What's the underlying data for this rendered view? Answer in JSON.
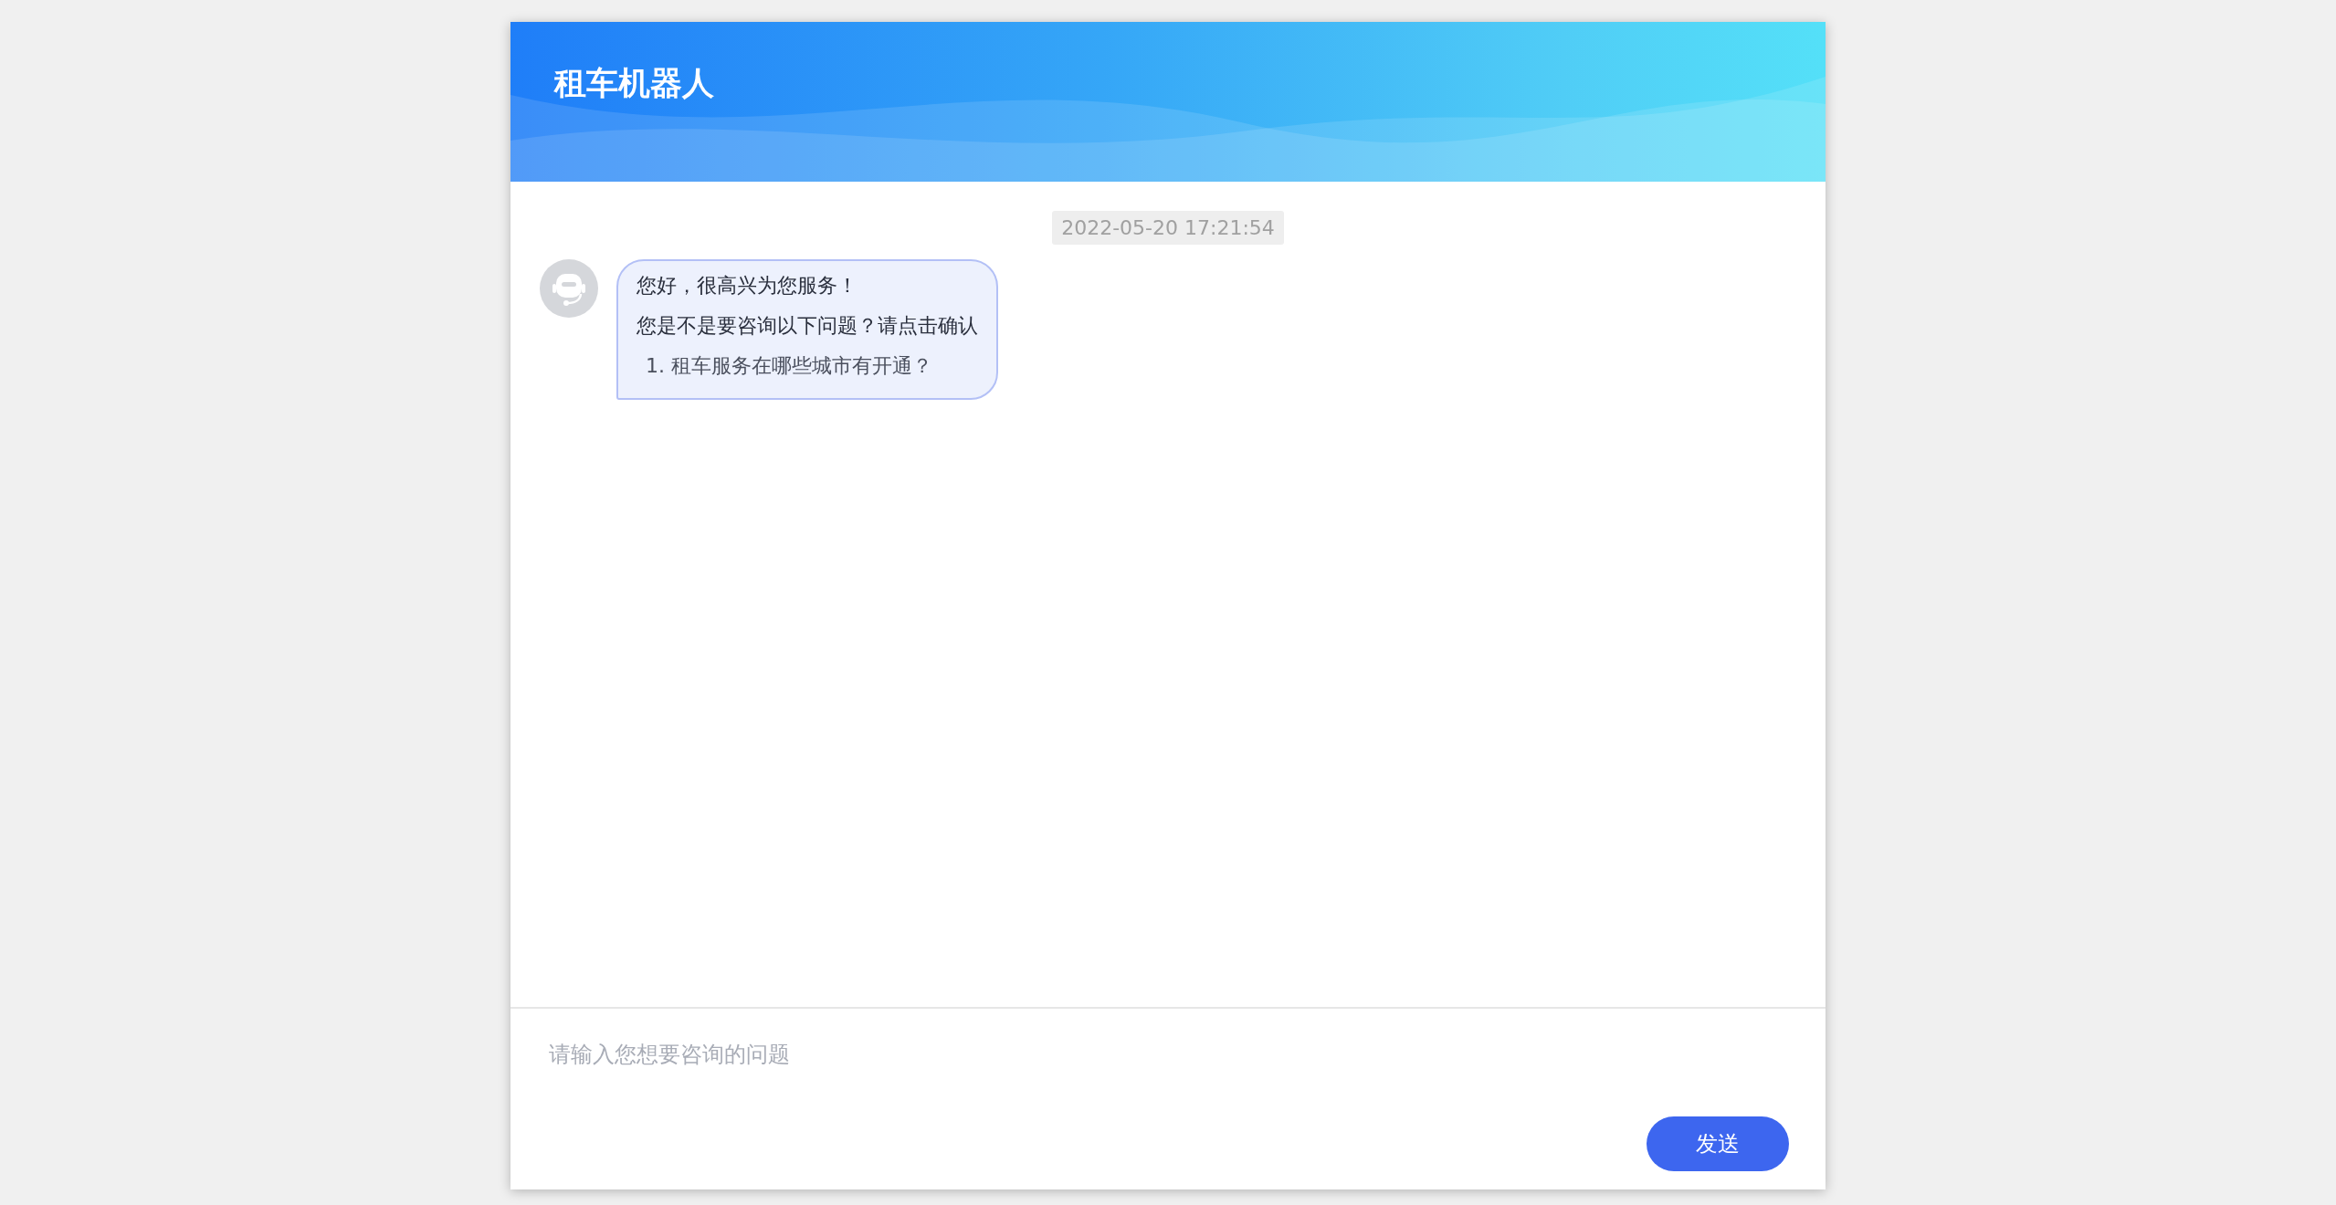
{
  "header": {
    "title": "租车机器人"
  },
  "chat": {
    "timestamp": "2022-05-20 17:21:54",
    "messages": [
      {
        "kind": "bot",
        "lines": [
          "您好，很高兴为您服务！",
          "您是不是要咨询以下问题？请点击确认"
        ],
        "questions": [
          "1. 租车服务在哪些城市有开通？"
        ]
      }
    ]
  },
  "composer": {
    "placeholder": "请输入您想要咨询的问题",
    "send_label": "发送"
  }
}
